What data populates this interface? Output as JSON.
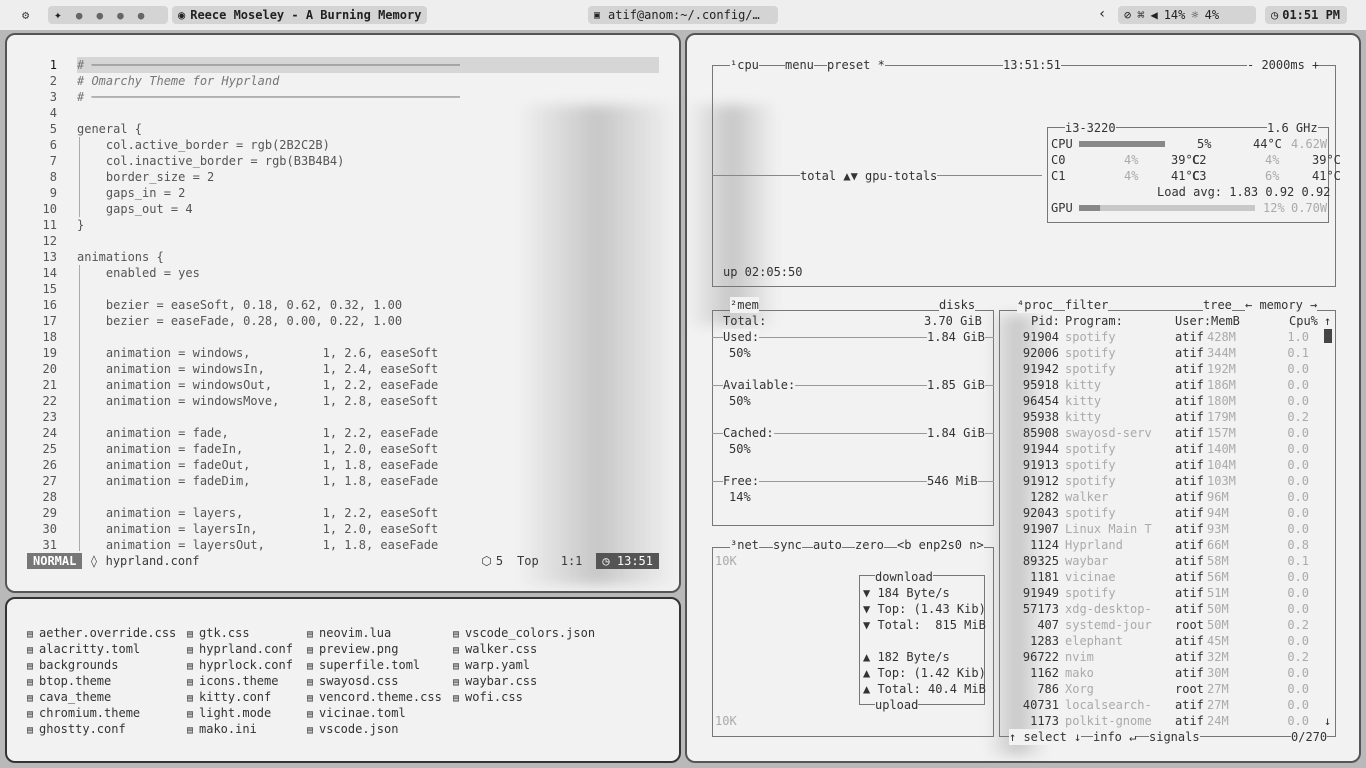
{
  "topbar": {
    "ws_active": "✦",
    "ws_dots": [
      "●",
      "●",
      "●",
      "●"
    ],
    "song": "Reece Moseley - A Burning Memory",
    "window_title": "atif@anom:~/.config/…",
    "volume": "14%",
    "brightness": "4%",
    "clock": "01:51 PM"
  },
  "editor": {
    "lines": [
      {
        "n": "1",
        "t": "# ───────────────────────────────────────────────────"
      },
      {
        "n": "2",
        "t": "# Omarchy Theme for Hyprland"
      },
      {
        "n": "3",
        "t": "# ───────────────────────────────────────────────────"
      },
      {
        "n": "4",
        "t": ""
      },
      {
        "n": "5",
        "t": "general {"
      },
      {
        "n": "6",
        "t": "    col.active_border = rgb(2B2C2B)"
      },
      {
        "n": "7",
        "t": "    col.inactive_border = rgb(B3B4B4)"
      },
      {
        "n": "8",
        "t": "    border_size = 2"
      },
      {
        "n": "9",
        "t": "    gaps_in = 2"
      },
      {
        "n": "10",
        "t": "    gaps_out = 4"
      },
      {
        "n": "11",
        "t": "}"
      },
      {
        "n": "12",
        "t": ""
      },
      {
        "n": "13",
        "t": "animations {"
      },
      {
        "n": "14",
        "t": "    enabled = yes"
      },
      {
        "n": "15",
        "t": ""
      },
      {
        "n": "16",
        "t": "    bezier = easeSoft, 0.18, 0.62, 0.32, 1.00"
      },
      {
        "n": "17",
        "t": "    bezier = easeFade, 0.28, 0.00, 0.22, 1.00"
      },
      {
        "n": "18",
        "t": ""
      },
      {
        "n": "19",
        "t": "    animation = windows,          1, 2.6, easeSoft"
      },
      {
        "n": "20",
        "t": "    animation = windowsIn,        1, 2.4, easeSoft"
      },
      {
        "n": "21",
        "t": "    animation = windowsOut,       1, 2.2, easeFade"
      },
      {
        "n": "22",
        "t": "    animation = windowsMove,      1, 2.8, easeSoft"
      },
      {
        "n": "23",
        "t": ""
      },
      {
        "n": "24",
        "t": "    animation = fade,             1, 2.2, easeFade"
      },
      {
        "n": "25",
        "t": "    animation = fadeIn,           1, 2.0, easeSoft"
      },
      {
        "n": "26",
        "t": "    animation = fadeOut,          1, 1.8, easeFade"
      },
      {
        "n": "27",
        "t": "    animation = fadeDim,          1, 1.8, easeFade"
      },
      {
        "n": "28",
        "t": ""
      },
      {
        "n": "29",
        "t": "    animation = layers,           1, 2.2, easeSoft"
      },
      {
        "n": "30",
        "t": "    animation = layersIn,         1, 2.0, easeSoft"
      },
      {
        "n": "31",
        "t": "    animation = layersOut,        1, 1.8, easeFade"
      }
    ],
    "status": {
      "mode": "NORMAL",
      "file": "hyprland.conf",
      "buf": "5",
      "pos": "Top",
      "cursor": "1:1",
      "time": "13:51"
    }
  },
  "files": {
    "col1": [
      "aether.override.css",
      "alacritty.toml",
      "backgrounds",
      "btop.theme",
      "cava_theme",
      "chromium.theme",
      "ghostty.conf"
    ],
    "col2": [
      "gtk.css",
      "hyprland.conf",
      "hyprlock.conf",
      "icons.theme",
      "kitty.conf",
      "light.mode",
      "mako.ini"
    ],
    "col3": [
      "neovim.lua",
      "preview.png",
      "superfile.toml",
      "swayosd.css",
      "vencord.theme.css",
      "vicinae.toml",
      "vscode.json"
    ],
    "col4": [
      "vscode_colors.json",
      "walker.css",
      "warp.yaml",
      "waybar.css",
      "wofi.css"
    ]
  },
  "btop": {
    "cpu": {
      "header": [
        "¹cpu",
        "menu",
        "preset *"
      ],
      "time": "13:51:51",
      "interval": "- 2000ms +",
      "total_label": "total ▲▼ gpu-totals",
      "uptime": "up 02:05:50",
      "model": "i3-3220",
      "freq": "1.6 GHz",
      "cpu_pct": "5%",
      "cpu_temp": "44°C",
      "cpu_watt": "4.62W",
      "cores": [
        [
          "C0",
          "4%",
          "39°C"
        ],
        [
          "C1",
          "4%",
          "41°C"
        ],
        [
          "C2",
          "4%",
          "39°C"
        ],
        [
          "C3",
          "6%",
          "41°C"
        ]
      ],
      "load": "Load avg: 1.83 0.92 0.92",
      "gpu_pct": "12%",
      "gpu_watt": "0.70W",
      "gpu_level": 0.12
    },
    "mem": {
      "title": "²mem",
      "disks": "disks",
      "total": "3.70 GiB",
      "used": "1.84 GiB",
      "used_pct": "50%",
      "avail": "1.85 GiB",
      "avail_pct": "50%",
      "cached": "1.84 GiB",
      "cached_pct": "50%",
      "free": "546 MiB",
      "free_pct": "14%"
    },
    "net": {
      "title": "³net",
      "opts": [
        "sync",
        "auto",
        "zero",
        "<b enp2s0 n>"
      ],
      "scale_top": "10K",
      "scale_bot": "10K",
      "down_rate": "184 Byte/s",
      "down_top": "Top: (1.43 Kib)",
      "down_total": "Total:  815 MiB",
      "up_rate": "182 Byte/s",
      "up_top": "Top: (1.42 Kib)",
      "up_total": "Total: 40.4 MiB"
    },
    "proc": {
      "title": "⁴proc",
      "filter": "filter",
      "tree": "tree",
      "sort": "← memory →",
      "cols": [
        "Pid:",
        "Program:",
        "User:",
        "MemB",
        "Cpu%"
      ],
      "rows": [
        [
          "91904",
          "spotify",
          "atif",
          "428M",
          "1.0"
        ],
        [
          "92006",
          "spotify",
          "atif",
          "344M",
          "0.1"
        ],
        [
          "91942",
          "spotify",
          "atif",
          "192M",
          "0.0"
        ],
        [
          "95918",
          "kitty",
          "atif",
          "186M",
          "0.0"
        ],
        [
          "96454",
          "kitty",
          "atif",
          "180M",
          "0.0"
        ],
        [
          "95938",
          "kitty",
          "atif",
          "179M",
          "0.2"
        ],
        [
          "85908",
          "swayosd-serv",
          "atif",
          "157M",
          "0.0"
        ],
        [
          "91944",
          "spotify",
          "atif",
          "140M",
          "0.0"
        ],
        [
          "91913",
          "spotify",
          "atif",
          "104M",
          "0.0"
        ],
        [
          "91912",
          "spotify",
          "atif",
          "103M",
          "0.0"
        ],
        [
          "1282",
          "walker",
          "atif",
          "96M",
          "0.0"
        ],
        [
          "92043",
          "spotify",
          "atif",
          "94M",
          "0.0"
        ],
        [
          "91907",
          "Linux Main T",
          "atif",
          "93M",
          "0.0"
        ],
        [
          "1124",
          "Hyprland",
          "atif",
          "66M",
          "0.8"
        ],
        [
          "89325",
          "waybar",
          "atif",
          "58M",
          "0.1"
        ],
        [
          "1181",
          "vicinae",
          "atif",
          "56M",
          "0.0"
        ],
        [
          "91949",
          "spotify",
          "atif",
          "51M",
          "0.0"
        ],
        [
          "57173",
          "xdg-desktop-",
          "atif",
          "50M",
          "0.0"
        ],
        [
          "407",
          "systemd-jour",
          "root",
          "50M",
          "0.2"
        ],
        [
          "1283",
          "elephant",
          "atif",
          "45M",
          "0.0"
        ],
        [
          "96722",
          "nvim",
          "atif",
          "32M",
          "0.2"
        ],
        [
          "1162",
          "mako",
          "atif",
          "30M",
          "0.0"
        ],
        [
          "786",
          "Xorg",
          "root",
          "27M",
          "0.0"
        ],
        [
          "40731",
          "localsearch-",
          "atif",
          "27M",
          "0.0"
        ],
        [
          "1173",
          "polkit-gnome",
          "atif",
          "24M",
          "0.0"
        ]
      ],
      "footer": [
        "↑ select ↓",
        "info ↵",
        "signals"
      ],
      "count": "0/270"
    }
  }
}
